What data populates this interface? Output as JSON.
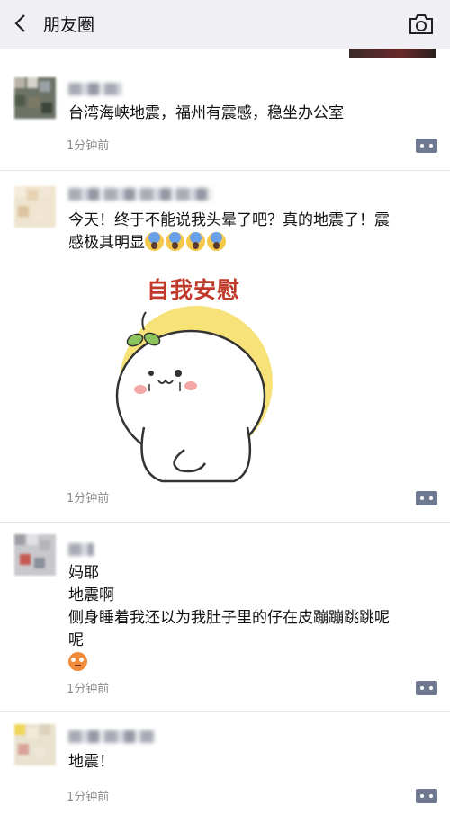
{
  "nav": {
    "title": "朋友圈",
    "back_icon": "chevron-left-icon",
    "camera_icon": "camera-icon",
    "background": "#efeff4"
  },
  "posts": [
    {
      "text": "台湾海峡地震，福州有震感，稳坐办公室",
      "time": "1分钟前"
    },
    {
      "text_line1": "今天！终于不能说我头晕了吧？真的地震了！震",
      "text_line2": "感极其明显",
      "emojis": [
        "scream-emoji",
        "scream-emoji",
        "scream-emoji",
        "scream-emoji"
      ],
      "sticker_caption": "自我安慰",
      "time": "1分钟前"
    },
    {
      "lines": [
        "妈耶",
        "地震啊",
        "侧身睡着我还以为我肚子里的仔在皮蹦蹦跳跳呢",
        "呢"
      ],
      "emoji": "flushed-emoji",
      "time": "1分钟前"
    },
    {
      "text": "地震！",
      "time": "1分钟前"
    }
  ],
  "colors": {
    "comment_button": "#6f7a92",
    "time_text": "#8b8b8b",
    "sticker_caption": "#c0392b"
  }
}
